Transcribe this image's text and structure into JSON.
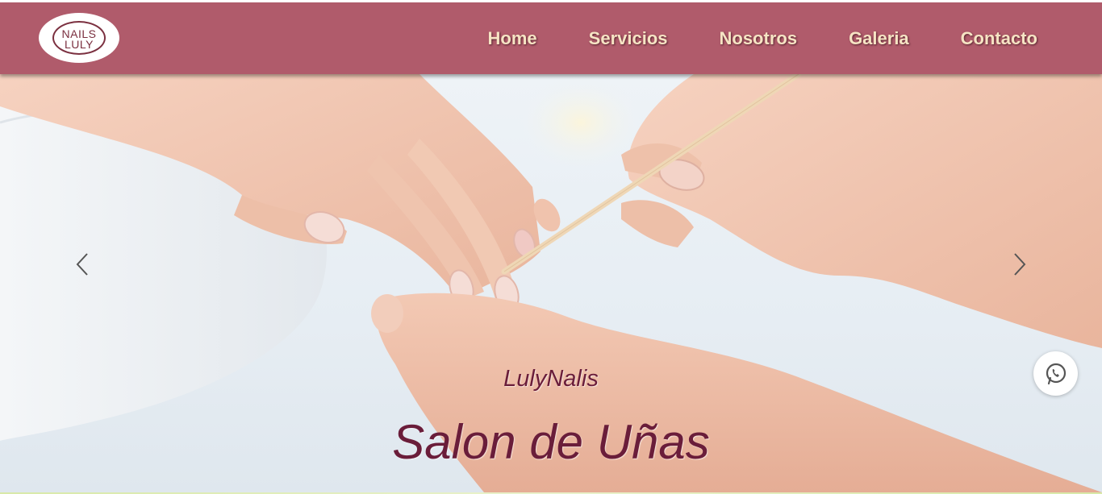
{
  "logo": {
    "line1": "NAILS",
    "line2": "LULY",
    "icon": "nail-polish-logo-icon"
  },
  "nav": {
    "items": [
      {
        "label": "Home"
      },
      {
        "label": "Servicios"
      },
      {
        "label": "Nosotros"
      },
      {
        "label": "Galeria"
      },
      {
        "label": "Contacto"
      }
    ]
  },
  "carousel": {
    "subtitle": "LulyNalis",
    "title": "Salon de Uñas",
    "prev_icon": "chevron-left-icon",
    "next_icon": "chevron-right-icon",
    "image": "manicure-hands-photo"
  },
  "floating": {
    "whatsapp_icon": "whatsapp-icon"
  },
  "colors": {
    "navbar": "#b05b6b",
    "nav_text": "#f6e4c4",
    "caption": "#6a1d3a"
  }
}
